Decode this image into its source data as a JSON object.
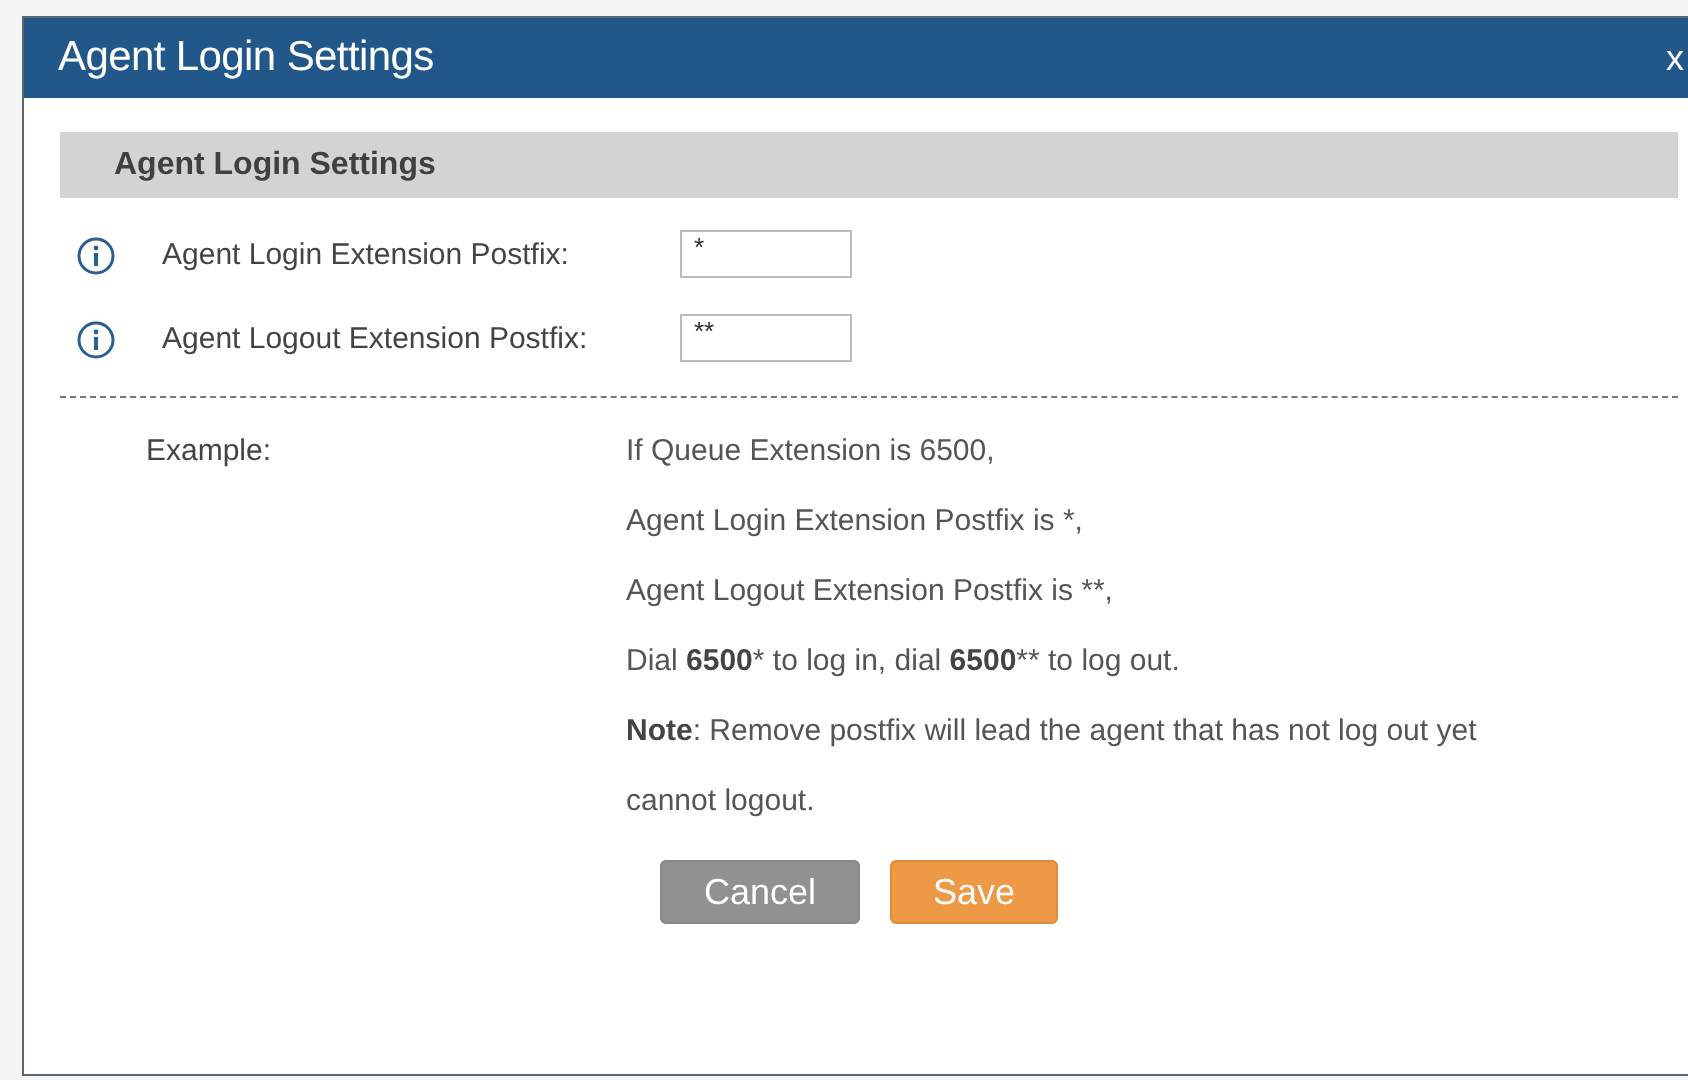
{
  "dialog": {
    "title": "Agent Login Settings",
    "close": "x"
  },
  "section": {
    "title": "Agent Login Settings"
  },
  "fields": [
    {
      "label": "Agent Login Extension Postfix:",
      "value": "*"
    },
    {
      "label": "Agent Logout Extension Postfix:",
      "value": "**"
    }
  ],
  "example": {
    "label": "Example:",
    "lines": [
      "If Queue Extension is 6500,",
      "Agent Login Extension Postfix is *,",
      "Agent Logout Extension Postfix is **,",
      "Dial **6500*** to log in, dial **6500**** to log out.",
      "**Note**: Remove postfix will lead the agent that has not log out yet",
      "cannot logout."
    ]
  },
  "buttons": [
    {
      "label": "Cancel",
      "kind": "secondary"
    },
    {
      "label": "Save",
      "kind": "primary"
    }
  ]
}
